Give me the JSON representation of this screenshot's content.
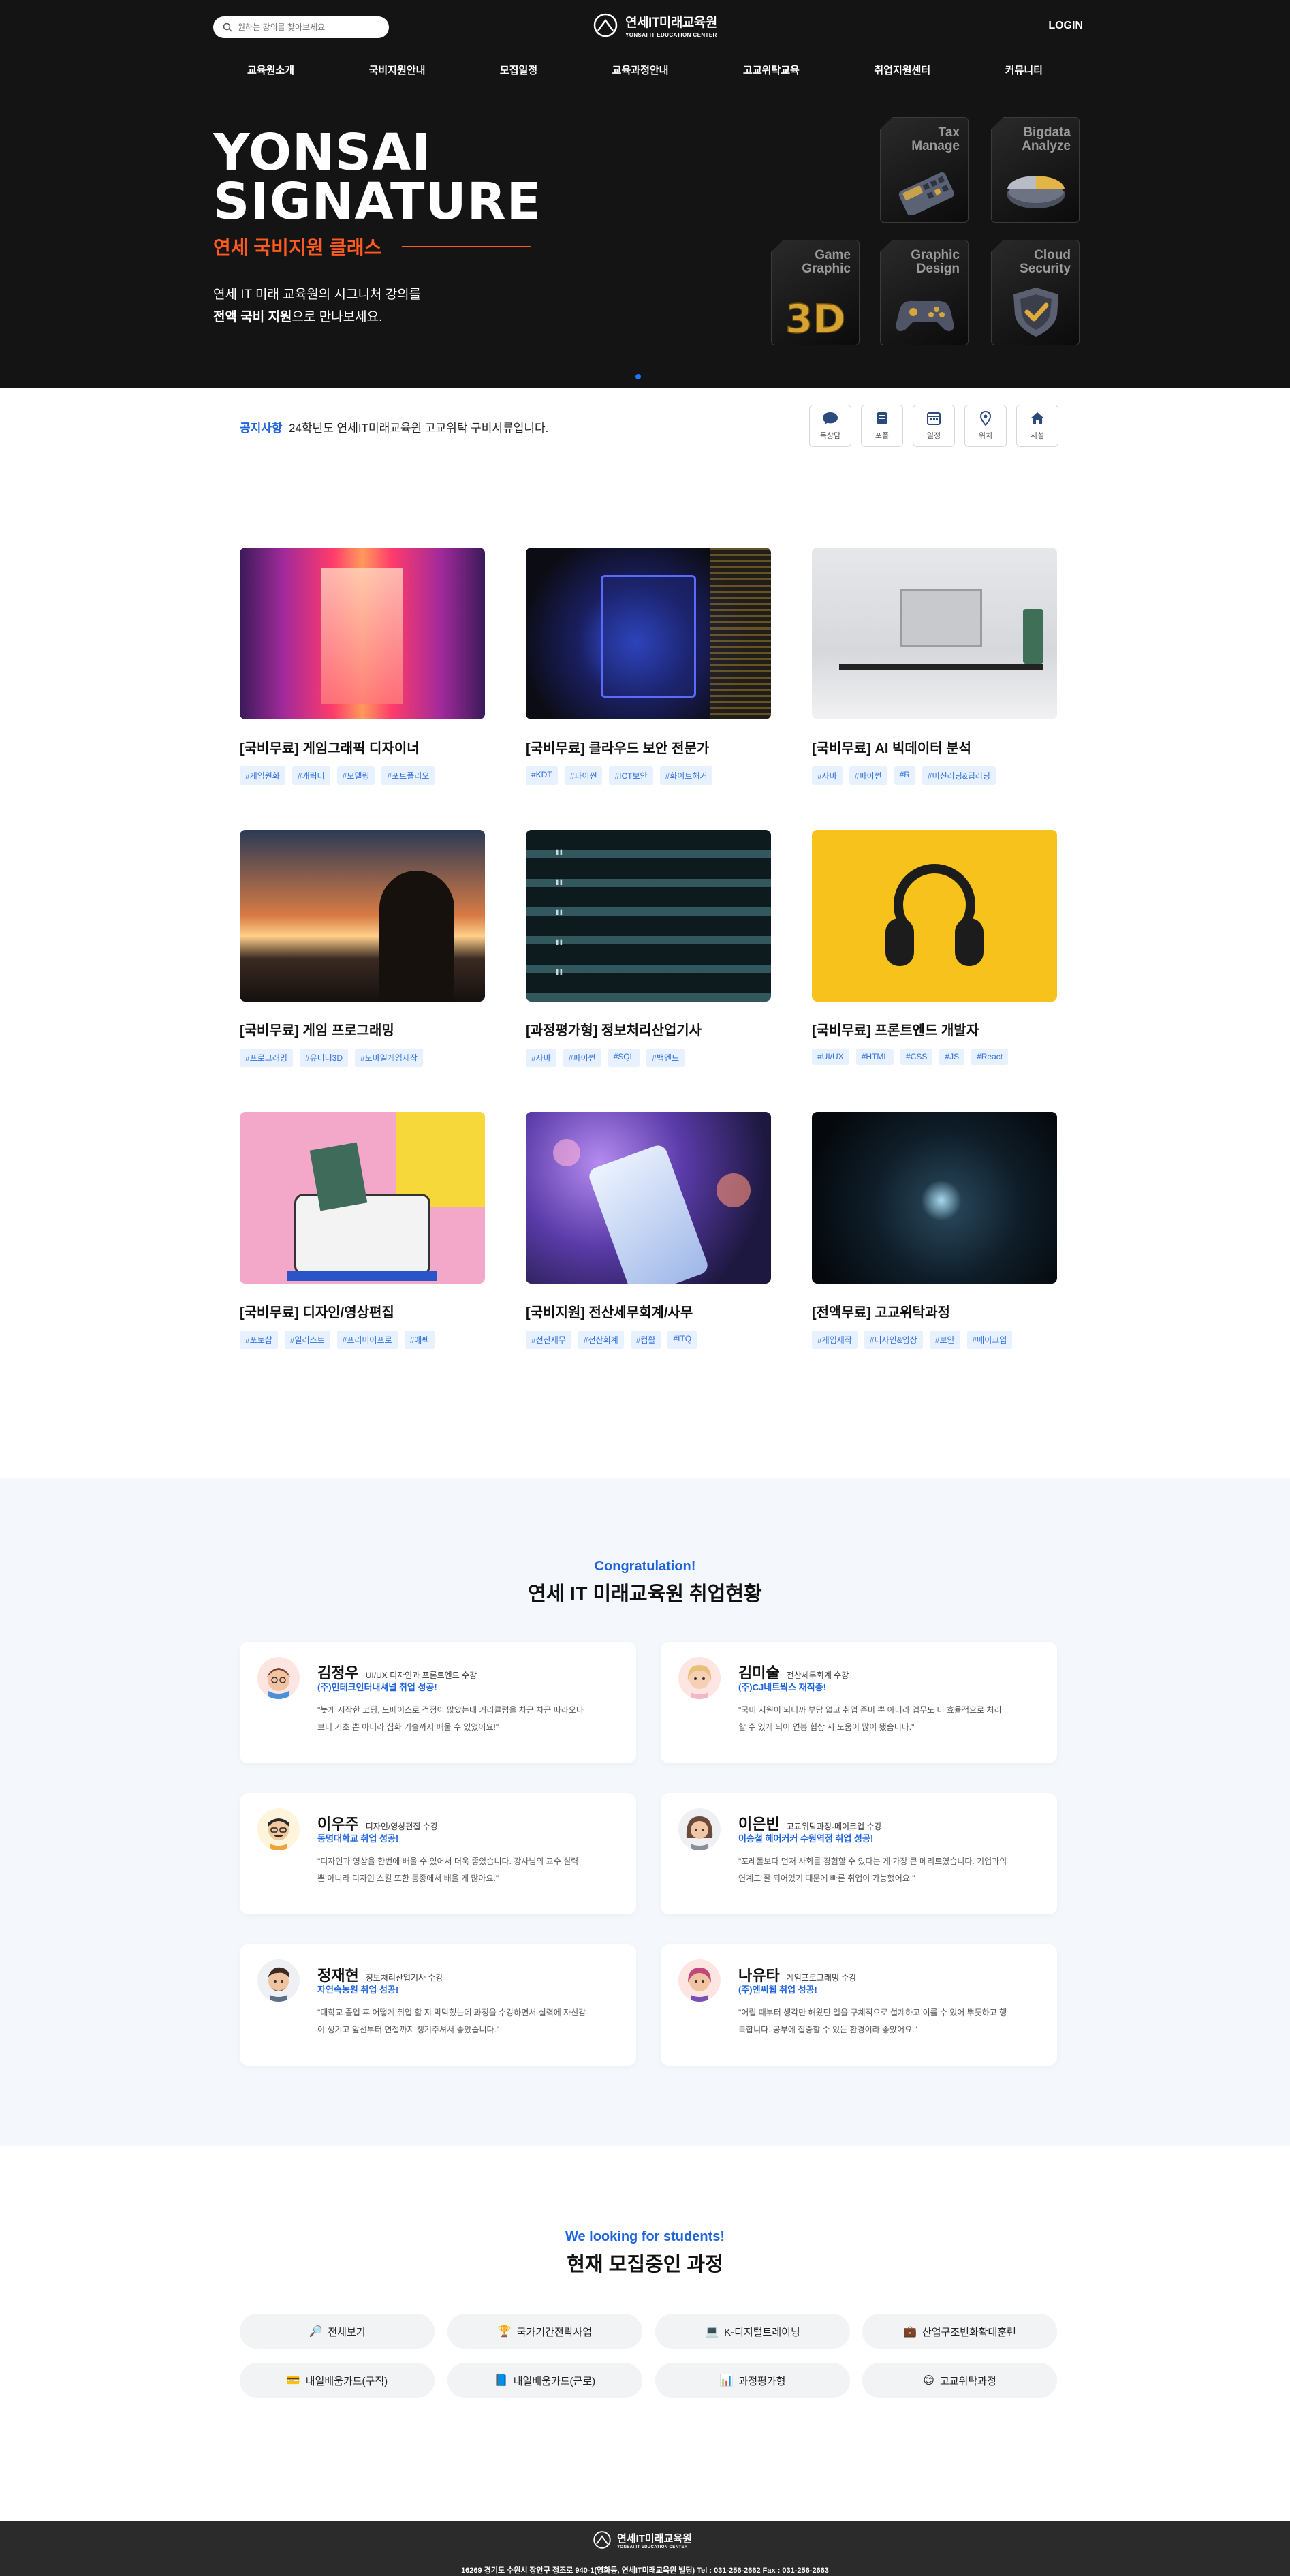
{
  "header": {
    "search_placeholder": "원하는 강의를 찾아보세요",
    "logo_name": "연세IT미래교육원",
    "logo_sub": "YONSAI IT EDUCATION CENTER",
    "login_label": "LOGIN",
    "nav": [
      "교육원소개",
      "국비지원안내",
      "모집일정",
      "교육과정안내",
      "고교위탁교육",
      "취업지원센터",
      "커뮤니티"
    ]
  },
  "hero": {
    "title_line1": "YONSAI",
    "title_line2": "SIGNATURE",
    "subtitle": "연세 국비지원 클래스",
    "desc_line1": "연세 IT 미래 교육원의 시그니처 강의를",
    "desc_line2_bold": "전액 국비 지원",
    "desc_line2_rest": "으로 만나보세요.",
    "tiles": [
      {
        "label1": "Tax",
        "label2": "Manage",
        "icon": "calculator-icon"
      },
      {
        "label1": "Bigdata",
        "label2": "Analyze",
        "icon": "pie-chart-icon"
      },
      {
        "label1": "Game",
        "label2": "Graphic",
        "icon": "3d-text-icon"
      },
      {
        "label1": "Graphic",
        "label2": "Design",
        "icon": "gamepad-icon"
      },
      {
        "label1": "Cloud",
        "label2": "Security",
        "icon": "shield-check-icon"
      }
    ]
  },
  "notice": {
    "label": "공지사항",
    "text": "24학년도 연세IT미래교육원 고교위탁 구비서류입니다.",
    "quick": [
      {
        "label": "독상담",
        "icon": "chat-icon"
      },
      {
        "label": "포폴",
        "icon": "book-icon"
      },
      {
        "label": "일정",
        "icon": "calendar-icon"
      },
      {
        "label": "위치",
        "icon": "location-pin-icon"
      },
      {
        "label": "시설",
        "icon": "home-icon"
      }
    ]
  },
  "courses": [
    {
      "title": "[국비무료] 게임그래픽 디자이너",
      "tags": [
        "#게임원화",
        "#캐릭터",
        "#모델링",
        "#포트폴리오"
      ],
      "thumb": "neon-corridor"
    },
    {
      "title": "[국비무료] 클라우드 보안 전문가",
      "tags": [
        "#KDT",
        "#파이썬",
        "#ICT보안",
        "#화이트해커"
      ],
      "thumb": "server-room"
    },
    {
      "title": "[국비무료] AI 빅데이터 분석",
      "tags": [
        "#자바",
        "#파이썬",
        "#R",
        "#머신러닝&딥러닝"
      ],
      "thumb": "office-desk"
    },
    {
      "title": "[국비무료] 게임 프로그래밍",
      "tags": [
        "#프로그래밍",
        "#유니티3D",
        "#모바일게임제작"
      ],
      "thumb": "sunset-window"
    },
    {
      "title": "[과정평가형] 정보처리산업기사",
      "tags": [
        "#자바",
        "#파이썬",
        "#SQL",
        "#백엔드"
      ],
      "thumb": "code-screen"
    },
    {
      "title": "[국비무료] 프론트엔드 개발자",
      "tags": [
        "#UI/UX",
        "#HTML",
        "#CSS",
        "#JS",
        "#React"
      ],
      "thumb": "headphones"
    },
    {
      "title": "[국비무료] 디자인/영상편집",
      "tags": [
        "#포토샵",
        "#일러스트",
        "#프리미어프로",
        "#애펙"
      ],
      "thumb": "toaster-art"
    },
    {
      "title": "[국비지원] 전산세무회계/사무",
      "tags": [
        "#전산세무",
        "#전산회계",
        "#컴활",
        "#ITQ"
      ],
      "thumb": "smartphone-bokeh"
    },
    {
      "title": "[전액무료] 고교위탁과정",
      "tags": [
        "#게임제작",
        "#디자인&영상",
        "#보안",
        "#메이크업"
      ],
      "thumb": "dark-particles"
    }
  ],
  "employment": {
    "eyebrow": "Congratulation!",
    "heading": "연세 IT 미래교육원 취업현황",
    "reviews": [
      {
        "name": "김정우",
        "course": "UI/UX 디자인과 프론트엔드 수강",
        "hire": "(주)인테크인터내셔널 취업 성공!",
        "line1": "\"늦게 시작한 코딩, 노베이스로 걱정이 많았는데 커리큘럼을 차근 차근 따라오다",
        "line2": "보니 기초 뿐 아니라 심화 기술까지 배울 수 있었어요!\"",
        "avatar_bg": "#fde6e1"
      },
      {
        "name": "김미술",
        "course": "전산세무회계 수강",
        "hire": "(주)CJ네트웍스 재직중!",
        "line1": "\"국비 지원이 되니까 부담 없고 취업 준비 뿐 아니라 업무도 더 효율적으로 처리",
        "line2": "할 수 있게 되어 연봉 협상 시 도움이 많이 됐습니다.\"",
        "avatar_bg": "#fde6e1"
      },
      {
        "name": "이우주",
        "course": "디자인/영상편집 수강",
        "hire": "동명대학교 취업 성공!",
        "line1": "\"디자인과 영상을 한번에 배울 수 있어서 더욱 좋았습니다. 강사님의 교수 실력",
        "line2": "뿐 아니라 디자인 스킬 또한 동종에서 배울 게 많아요.\"",
        "avatar_bg": "#fff4dc"
      },
      {
        "name": "이은빈",
        "course": "고교위탁과정-메이크업 수강",
        "hire": "이승철 헤어커커 수원역점 취업 성공!",
        "line1": "\"포레돌보다 먼저 사회를 경험할 수 있다는 게 가장 큰 메리트였습니다. 기업과의",
        "line2": "연계도 잘 되어있기 때문에 빠른 취업이 가능했어요.\"",
        "avatar_bg": "#eef0f3"
      },
      {
        "name": "정재현",
        "course": "정보처리산업기사 수강",
        "hire": "자연속농원 취업 성공!",
        "line1": "\"대학교 졸업 후 어떻게 취업 할 지 막막했는데 과정을 수강하면서 실력에 자신감",
        "line2": "이 생기고 앞선부터 면접까지 챙겨주셔서 좋았습니다.\"",
        "avatar_bg": "#eef0f3"
      },
      {
        "name": "나유타",
        "course": "게임프로그래밍 수강",
        "hire": "(주)엔씨웹 취업 성공!",
        "line1": "\"어릴 때부터 생각만 해왔던 일을 구체적으로 설계하고 이룰 수 있어 뿌듯하고 행",
        "line2": "복합니다. 공부에 집중할 수 있는 환경이라 좋았어요.\"",
        "avatar_bg": "#fde6e1"
      }
    ]
  },
  "recruit": {
    "eyebrow": "We looking for students!",
    "heading": "현재 모집중인 과정",
    "filters": [
      {
        "label": "전체보기",
        "icon": "🔎"
      },
      {
        "label": "국가기간전략사업",
        "icon": "🏆"
      },
      {
        "label": "K-디지털트레이닝",
        "icon": "💻"
      },
      {
        "label": "산업구조변화확대훈련",
        "icon": "💼"
      },
      {
        "label": "내일배움카드(구직)",
        "icon": "💳"
      },
      {
        "label": "내일배움카드(근로)",
        "icon": "📘"
      },
      {
        "label": "과정평가형",
        "icon": "📊"
      },
      {
        "label": "고교위탁과정",
        "icon": "😊"
      }
    ]
  },
  "footer": {
    "logo_name": "연세IT미래교육원",
    "logo_sub": "YONSAI IT EDUCATION CENTER",
    "address": "16269 경기도 수원시 장안구 정조로 940-1(영화동, 연세IT미래교육원 빌딩) Tel : 031-256-2662 Fax : 031-256-2663"
  },
  "colors": {
    "accent": "#1e64dc",
    "hero_orange": "#ff5a1f",
    "hero_bg": "#141414",
    "tag_bg": "#e8f1ff"
  }
}
